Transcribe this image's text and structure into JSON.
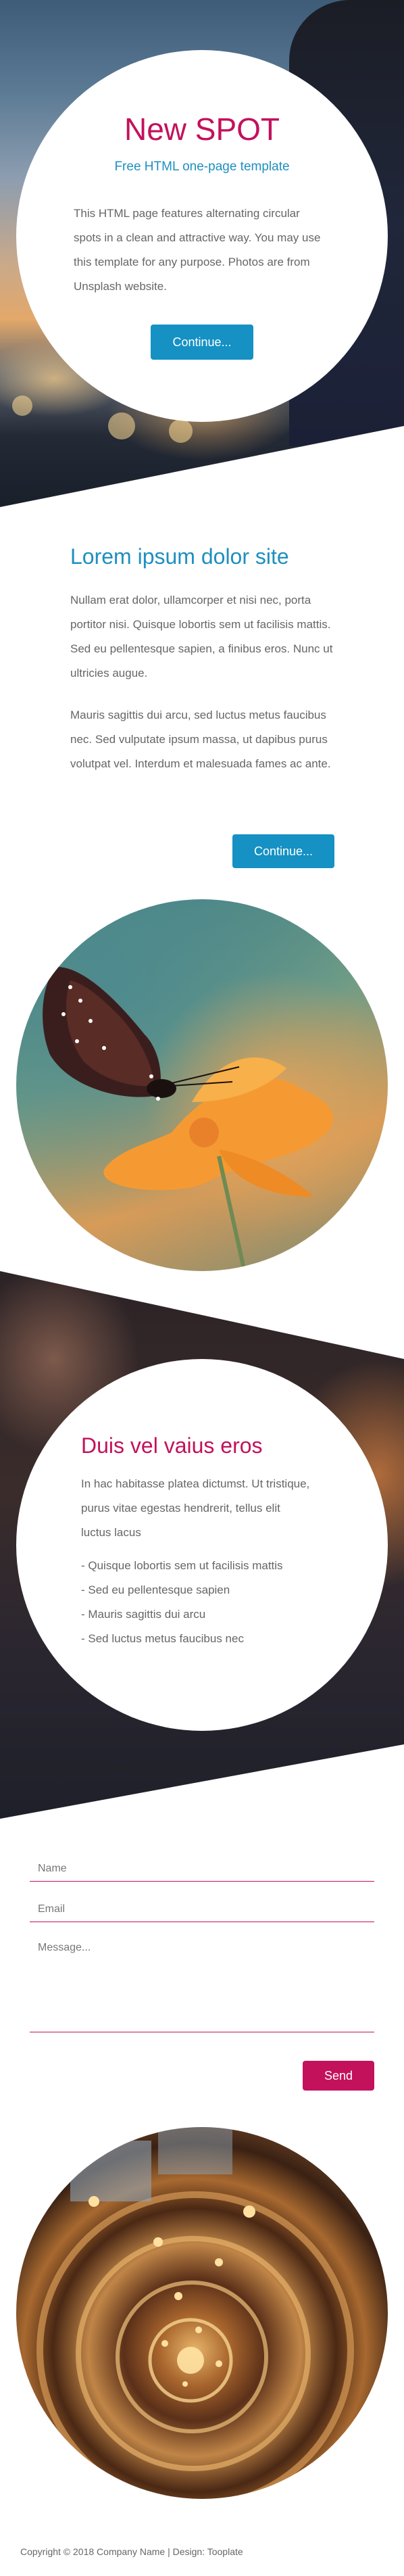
{
  "hero": {
    "title": "New SPOT",
    "subtitle": "Free HTML one-page template",
    "text": "This HTML page features alternating circular spots in a clean and attractive way. You may use this template for any purpose. Photos are from Unsplash website.",
    "button_label": "Continue..."
  },
  "about": {
    "title": "Lorem ipsum dolor site",
    "paragraph1": "Nullam erat dolor, ullamcorper et nisi nec, porta portitor nisi. Quisque lobortis sem ut facilisis mattis. Sed eu pellentesque sapien, a finibus eros. Nunc ut ultricies augue.",
    "paragraph2": "Mauris sagittis dui arcu, sed luctus metus faucibus nec. Sed vulputate ipsum massa, ut dapibus purus volutpat vel. Interdum et malesuada fames ac ante.",
    "button_label": "Continue..."
  },
  "duis": {
    "title": "Duis vel vaius eros",
    "paragraph": "In hac habitasse platea dictumst. Ut tristique, purus vitae egestas hendrerit, tellus elit luctus lacus",
    "items": [
      "- Quisque lobortis sem ut facilisis mattis",
      "- Sed eu pellentesque sapien",
      "- Mauris sagittis dui arcu",
      "- Sed luctus metus faucibus nec"
    ]
  },
  "contact": {
    "name_placeholder": "Name",
    "email_placeholder": "Email",
    "message_placeholder": "Message...",
    "send_label": "Send"
  },
  "footer": {
    "text": "Copyright © 2018 Company Name | Design: Tooplate"
  },
  "colors": {
    "accent_magenta": "#c3115c",
    "accent_blue": "#1591c3"
  }
}
